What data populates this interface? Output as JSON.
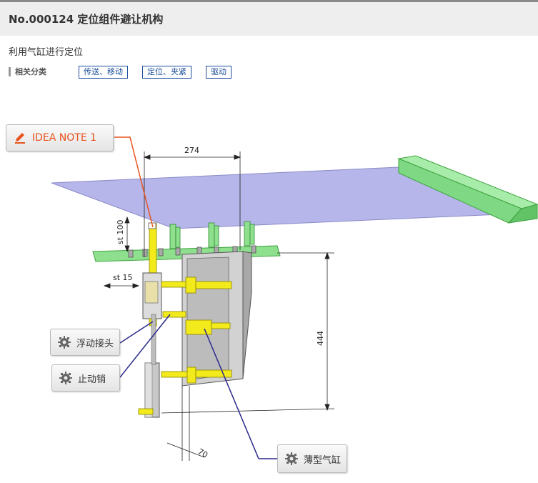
{
  "header": {
    "title": "No.000124 定位组件避让机构"
  },
  "subtitle": "利用气缸进行定位",
  "categories": {
    "label": "相关分类",
    "tags": [
      "传送、移动",
      "定位、夹紧",
      "驱动"
    ]
  },
  "diagram": {
    "dimensions": {
      "width_top": "274",
      "stroke_vertical": "st 100",
      "stroke_horizontal": "st 15",
      "height": "444",
      "depth": "70"
    }
  },
  "callouts": {
    "idea_note": "IDEA NOTE 1",
    "floating_joint": "浮动接头",
    "stop_pin": "止动销",
    "thin_cylinder": "薄型气缸"
  },
  "colors": {
    "plate": "#b6b6ea",
    "rail": "#8ee08e",
    "cylinder": "#f2ea1a",
    "frame": "#c8c8c8",
    "leader_idea": "#e8521c",
    "leader_part": "#2a2a8c"
  }
}
